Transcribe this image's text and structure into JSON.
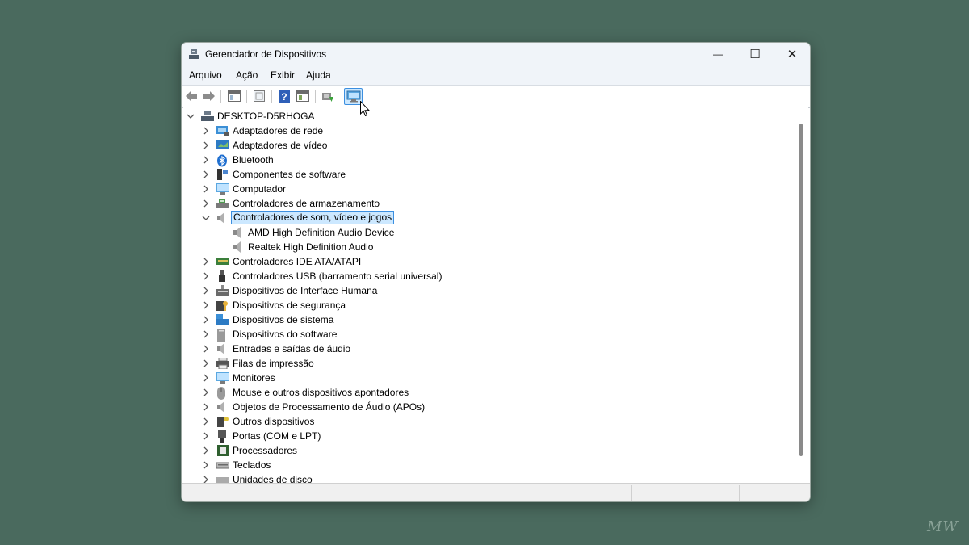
{
  "window": {
    "title": "Gerenciador de Dispositivos",
    "minimize": "—",
    "maximize": "☐",
    "close": "✕"
  },
  "menu": [
    "Arquivo",
    "Ação",
    "Exibir",
    "Ajuda"
  ],
  "toolbar": {
    "buttons": [
      "back-icon",
      "forward-icon",
      "show-hide-tree-icon",
      "properties-icon",
      "help-icon",
      "view-icon",
      "update-driver-icon",
      "scan-hardware-icon"
    ],
    "active": "scan-hardware-icon"
  },
  "tree": {
    "root": "DESKTOP-D5RHOGA",
    "items": [
      {
        "label": "Adaptadores de rede",
        "icon": "network-adapter-icon"
      },
      {
        "label": "Adaptadores de vídeo",
        "icon": "display-adapter-icon"
      },
      {
        "label": "Bluetooth",
        "icon": "bluetooth-icon"
      },
      {
        "label": "Componentes de software",
        "icon": "software-component-icon"
      },
      {
        "label": "Computador",
        "icon": "computer-icon"
      },
      {
        "label": "Controladores de armazenamento",
        "icon": "storage-controller-icon"
      },
      {
        "label": "Controladores de som, vídeo e jogos",
        "icon": "sound-icon",
        "expanded": true,
        "selected": true,
        "children": [
          "AMD High Definition Audio Device",
          "Realtek High Definition Audio"
        ]
      },
      {
        "label": "Controladores IDE ATA/ATAPI",
        "icon": "ide-controller-icon"
      },
      {
        "label": "Controladores USB (barramento serial universal)",
        "icon": "usb-icon"
      },
      {
        "label": "Dispositivos de Interface Humana",
        "icon": "hid-icon"
      },
      {
        "label": "Dispositivos de segurança",
        "icon": "security-device-icon"
      },
      {
        "label": "Dispositivos de sistema",
        "icon": "system-device-icon"
      },
      {
        "label": "Dispositivos do software",
        "icon": "software-device-icon"
      },
      {
        "label": "Entradas e saídas de áudio",
        "icon": "audio-io-icon"
      },
      {
        "label": "Filas de impressão",
        "icon": "printer-icon"
      },
      {
        "label": "Monitores",
        "icon": "monitor-icon"
      },
      {
        "label": "Mouse e outros dispositivos apontadores",
        "icon": "mouse-icon"
      },
      {
        "label": "Objetos de Processamento de Áudio (APOs)",
        "icon": "apo-icon"
      },
      {
        "label": "Outros dispositivos",
        "icon": "other-device-icon"
      },
      {
        "label": "Portas (COM e LPT)",
        "icon": "port-icon"
      },
      {
        "label": "Processadores",
        "icon": "processor-icon"
      },
      {
        "label": "Teclados",
        "icon": "keyboard-icon"
      },
      {
        "label": "Unidades de disco",
        "icon": "disk-drive-icon"
      }
    ]
  },
  "watermark": "MW",
  "colors": {
    "background": "#4a6a5e",
    "selection": "#cce8ff",
    "selection_border": "#3c8fe0",
    "titlebar": "#f0f4f9"
  }
}
